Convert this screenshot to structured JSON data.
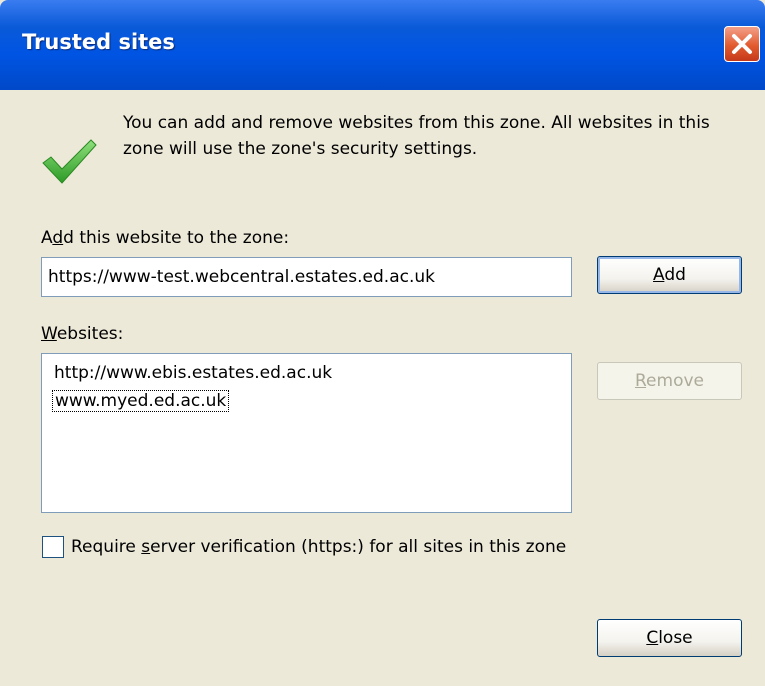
{
  "dialog": {
    "title": "Trusted sites",
    "intro": "You can add and remove websites from this zone. All websites in this zone will use the zone's security settings.",
    "add_label_pre": "A",
    "add_label_key": "d",
    "add_label_post": "d this website to the zone:",
    "url_value": "https://www-test.webcentral.estates.ed.ac.uk",
    "add_button_key": "A",
    "add_button_rest": "dd",
    "websites_label_key": "W",
    "websites_label_rest": "ebsites:",
    "websites": [
      "http://www.ebis.estates.ed.ac.uk",
      "www.myed.ed.ac.uk"
    ],
    "remove_button_key": "R",
    "remove_button_rest": "emove",
    "require_pre": "Require ",
    "require_key": "s",
    "require_post": "erver verification (https:) for all sites in this zone",
    "require_checked": false,
    "close_button_key": "C",
    "close_button_rest": "lose"
  },
  "icons": {
    "close": "close-icon",
    "check": "checkmark-icon"
  },
  "colors": {
    "titlebar": "#0054e3",
    "close_button": "#e25b2f",
    "dialog_bg": "#ece9d8",
    "check_green": "#3fae36"
  }
}
